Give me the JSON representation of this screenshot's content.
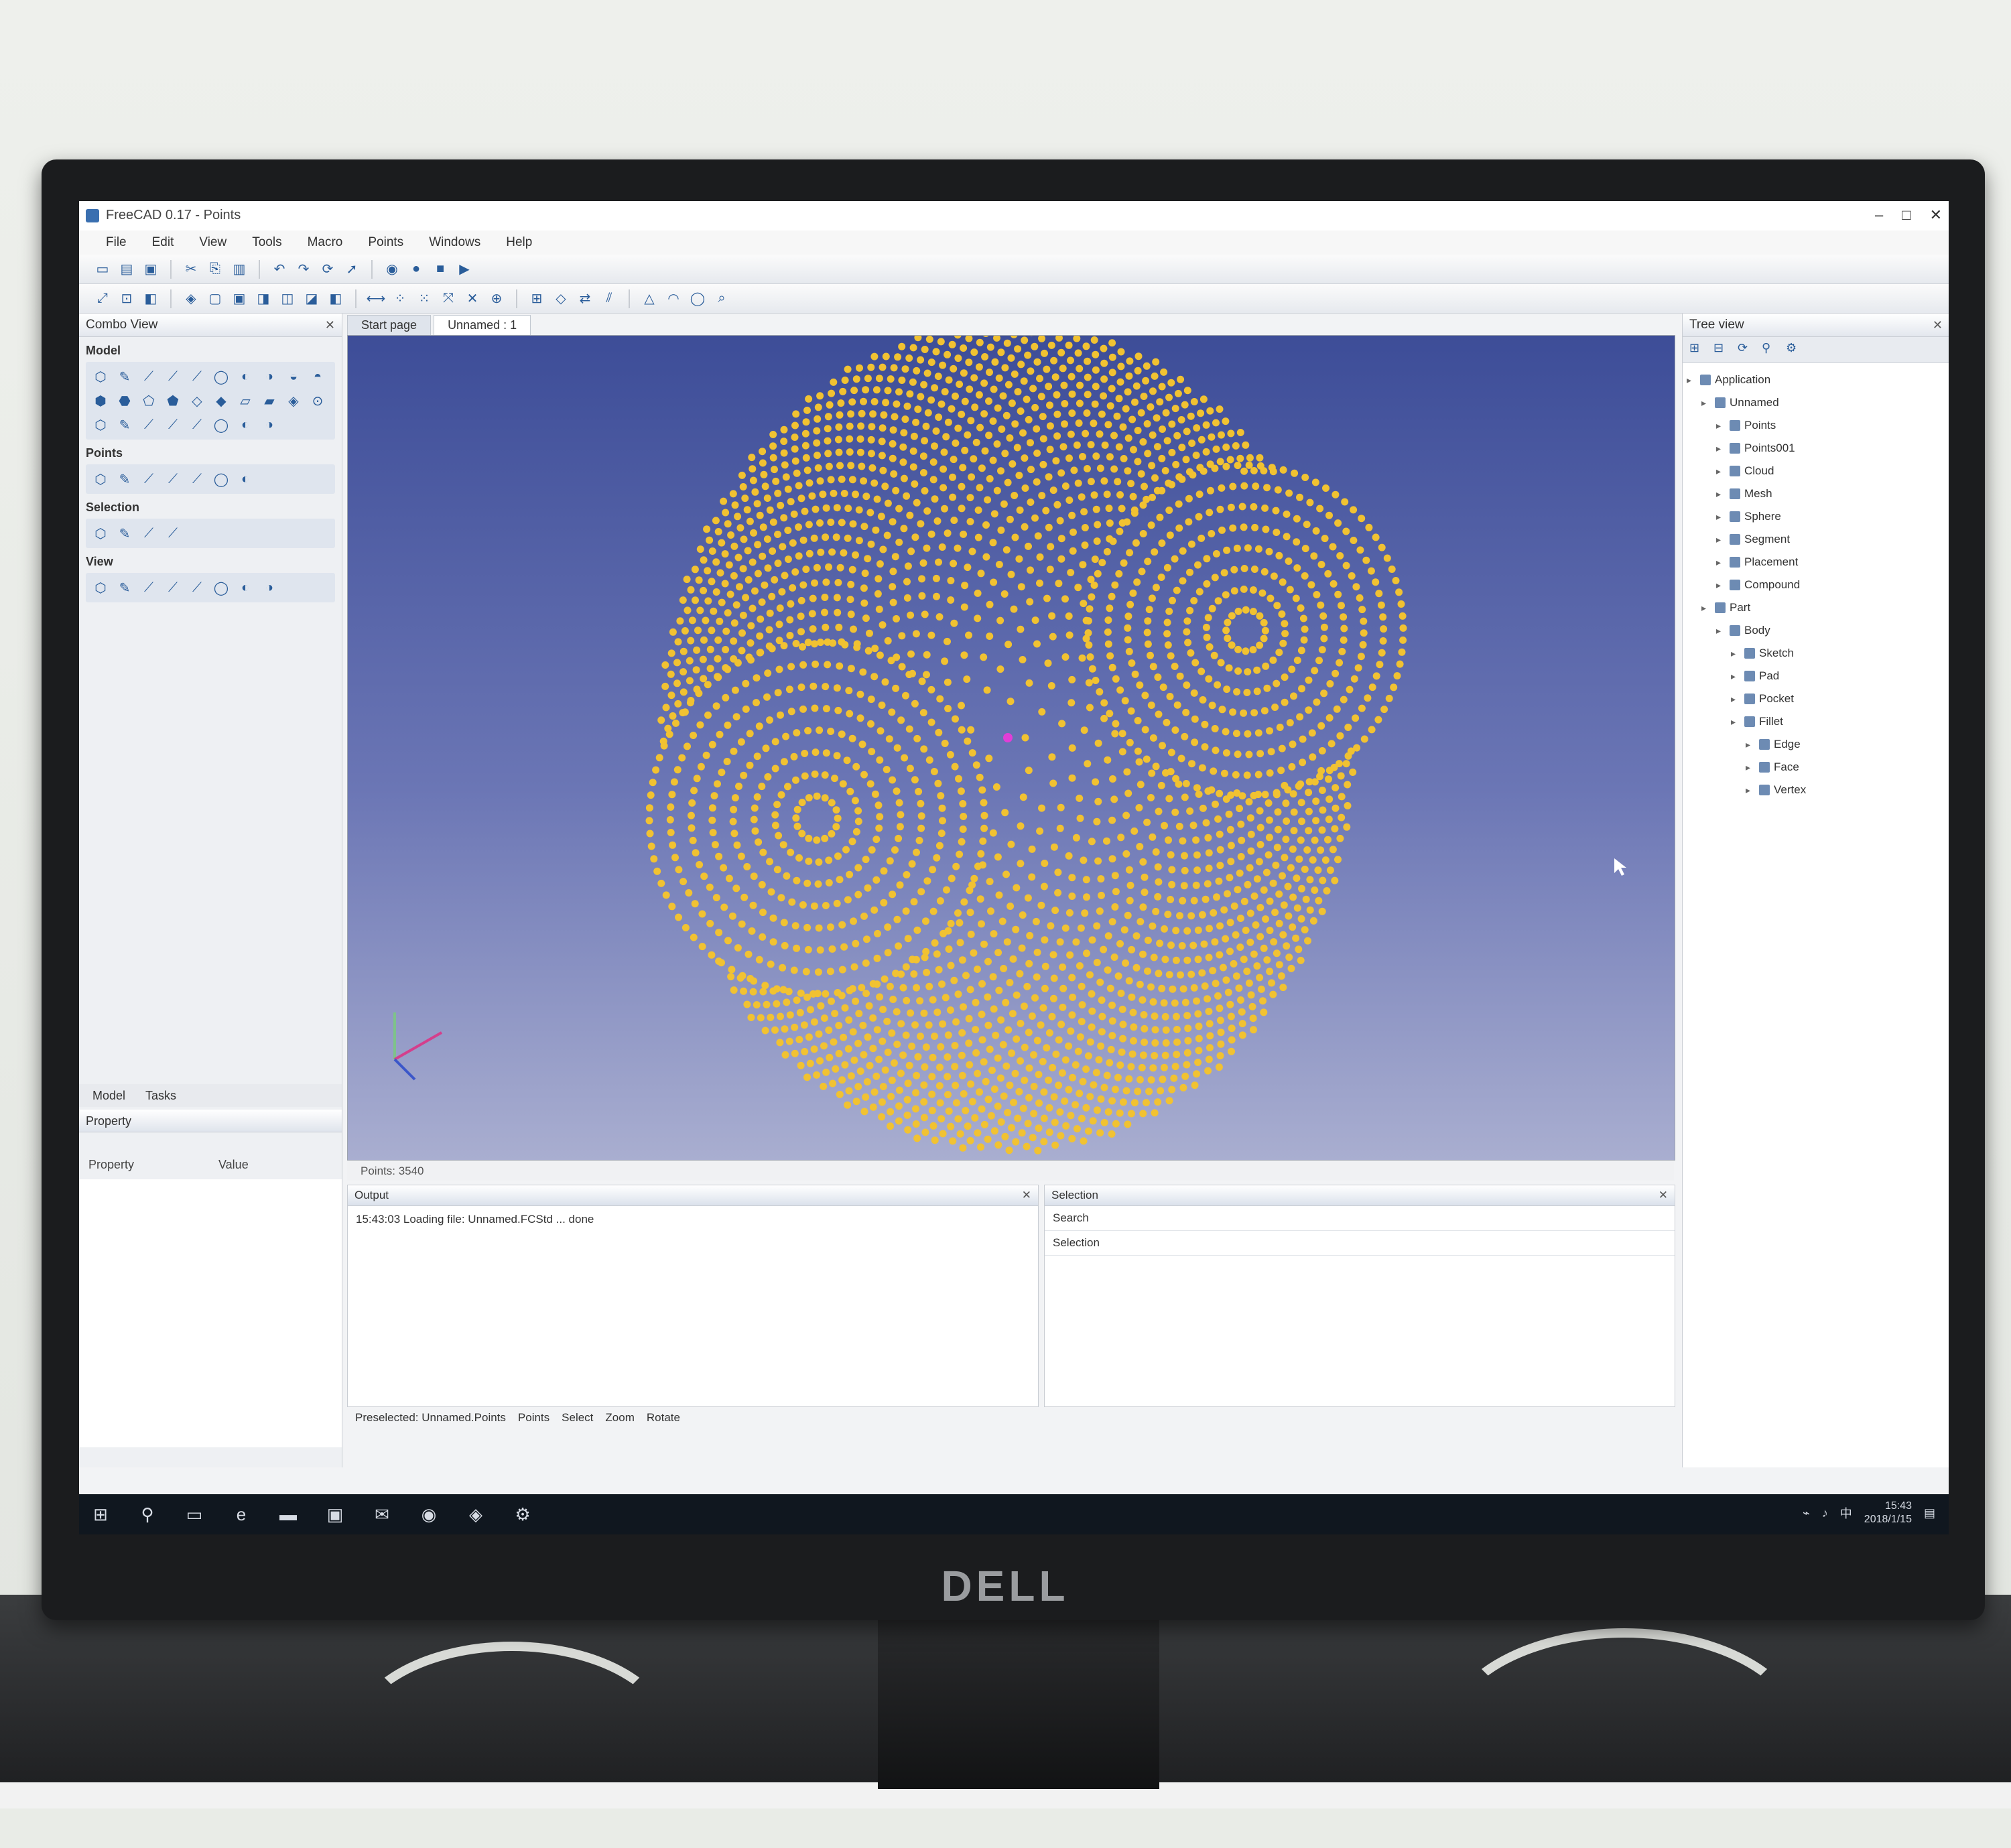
{
  "window": {
    "title": "FreeCAD 0.17 - Points",
    "controls": [
      "–",
      "□",
      "✕"
    ]
  },
  "menu": [
    "File",
    "Edit",
    "View",
    "Tools",
    "Macro",
    "Points",
    "Windows",
    "Help"
  ],
  "toolbar_icons": [
    "new-icon",
    "open-icon",
    "save-icon",
    "print-icon",
    "cut-icon",
    "copy-icon",
    "paste-icon",
    "undo-icon",
    "redo-icon",
    "refresh-icon",
    "pointer-icon",
    "macro-icon"
  ],
  "left_panel": {
    "title": "Combo View",
    "groups": [
      {
        "label": "Model",
        "icons": 28
      },
      {
        "label": "Points",
        "icons": 7
      },
      {
        "label": "Selection",
        "icons": 4
      },
      {
        "label": "View",
        "icons": 8
      }
    ],
    "tabs": [
      "Model",
      "Tasks"
    ],
    "property_header": "Property",
    "property_columns": [
      "Property",
      "Value"
    ]
  },
  "view": {
    "tabs": [
      "Start page",
      "Unnamed : 1"
    ],
    "status": "Points: 3540"
  },
  "right_panel": {
    "title": "Tree view",
    "tree": [
      {
        "label": "Application",
        "indent": 0
      },
      {
        "label": "Unnamed",
        "indent": 1
      },
      {
        "label": "Points",
        "indent": 2
      },
      {
        "label": "Points001",
        "indent": 2
      },
      {
        "label": "Cloud",
        "indent": 2
      },
      {
        "label": "Mesh",
        "indent": 2
      },
      {
        "label": "Sphere",
        "indent": 2
      },
      {
        "label": "Segment",
        "indent": 2
      },
      {
        "label": "Placement",
        "indent": 2
      },
      {
        "label": "Compound",
        "indent": 2
      },
      {
        "label": "Part",
        "indent": 1
      },
      {
        "label": "Body",
        "indent": 2
      },
      {
        "label": "Sketch",
        "indent": 3
      },
      {
        "label": "Pad",
        "indent": 3
      },
      {
        "label": "Pocket",
        "indent": 3
      },
      {
        "label": "Fillet",
        "indent": 3
      },
      {
        "label": "Edge",
        "indent": 4
      },
      {
        "label": "Face",
        "indent": 4
      },
      {
        "label": "Vertex",
        "indent": 4
      }
    ]
  },
  "output": {
    "title": "Output",
    "line": "15:43:03  Loading file: Unnamed.FCStd ... done"
  },
  "selection": {
    "title": "Selection",
    "rows": [
      "Search",
      "Selection"
    ]
  },
  "statusbar": [
    "Preselected: Unnamed.Points",
    "Points",
    "Select",
    "Zoom",
    "Rotate"
  ],
  "taskbar": {
    "icons": [
      "windows-icon",
      "search-icon",
      "task-view-icon",
      "edge-icon",
      "explorer-icon",
      "store-icon",
      "mail-icon",
      "chrome-icon",
      "app-icon",
      "freecad-icon"
    ],
    "time": "15:43",
    "date": "2018/1/15"
  },
  "monitor_brand": "DELL",
  "colors": {
    "points": "#f1c232",
    "viewport_top": "#3d4d98",
    "viewport_bottom": "#a9aed0",
    "accent": "#2a5d9a"
  }
}
